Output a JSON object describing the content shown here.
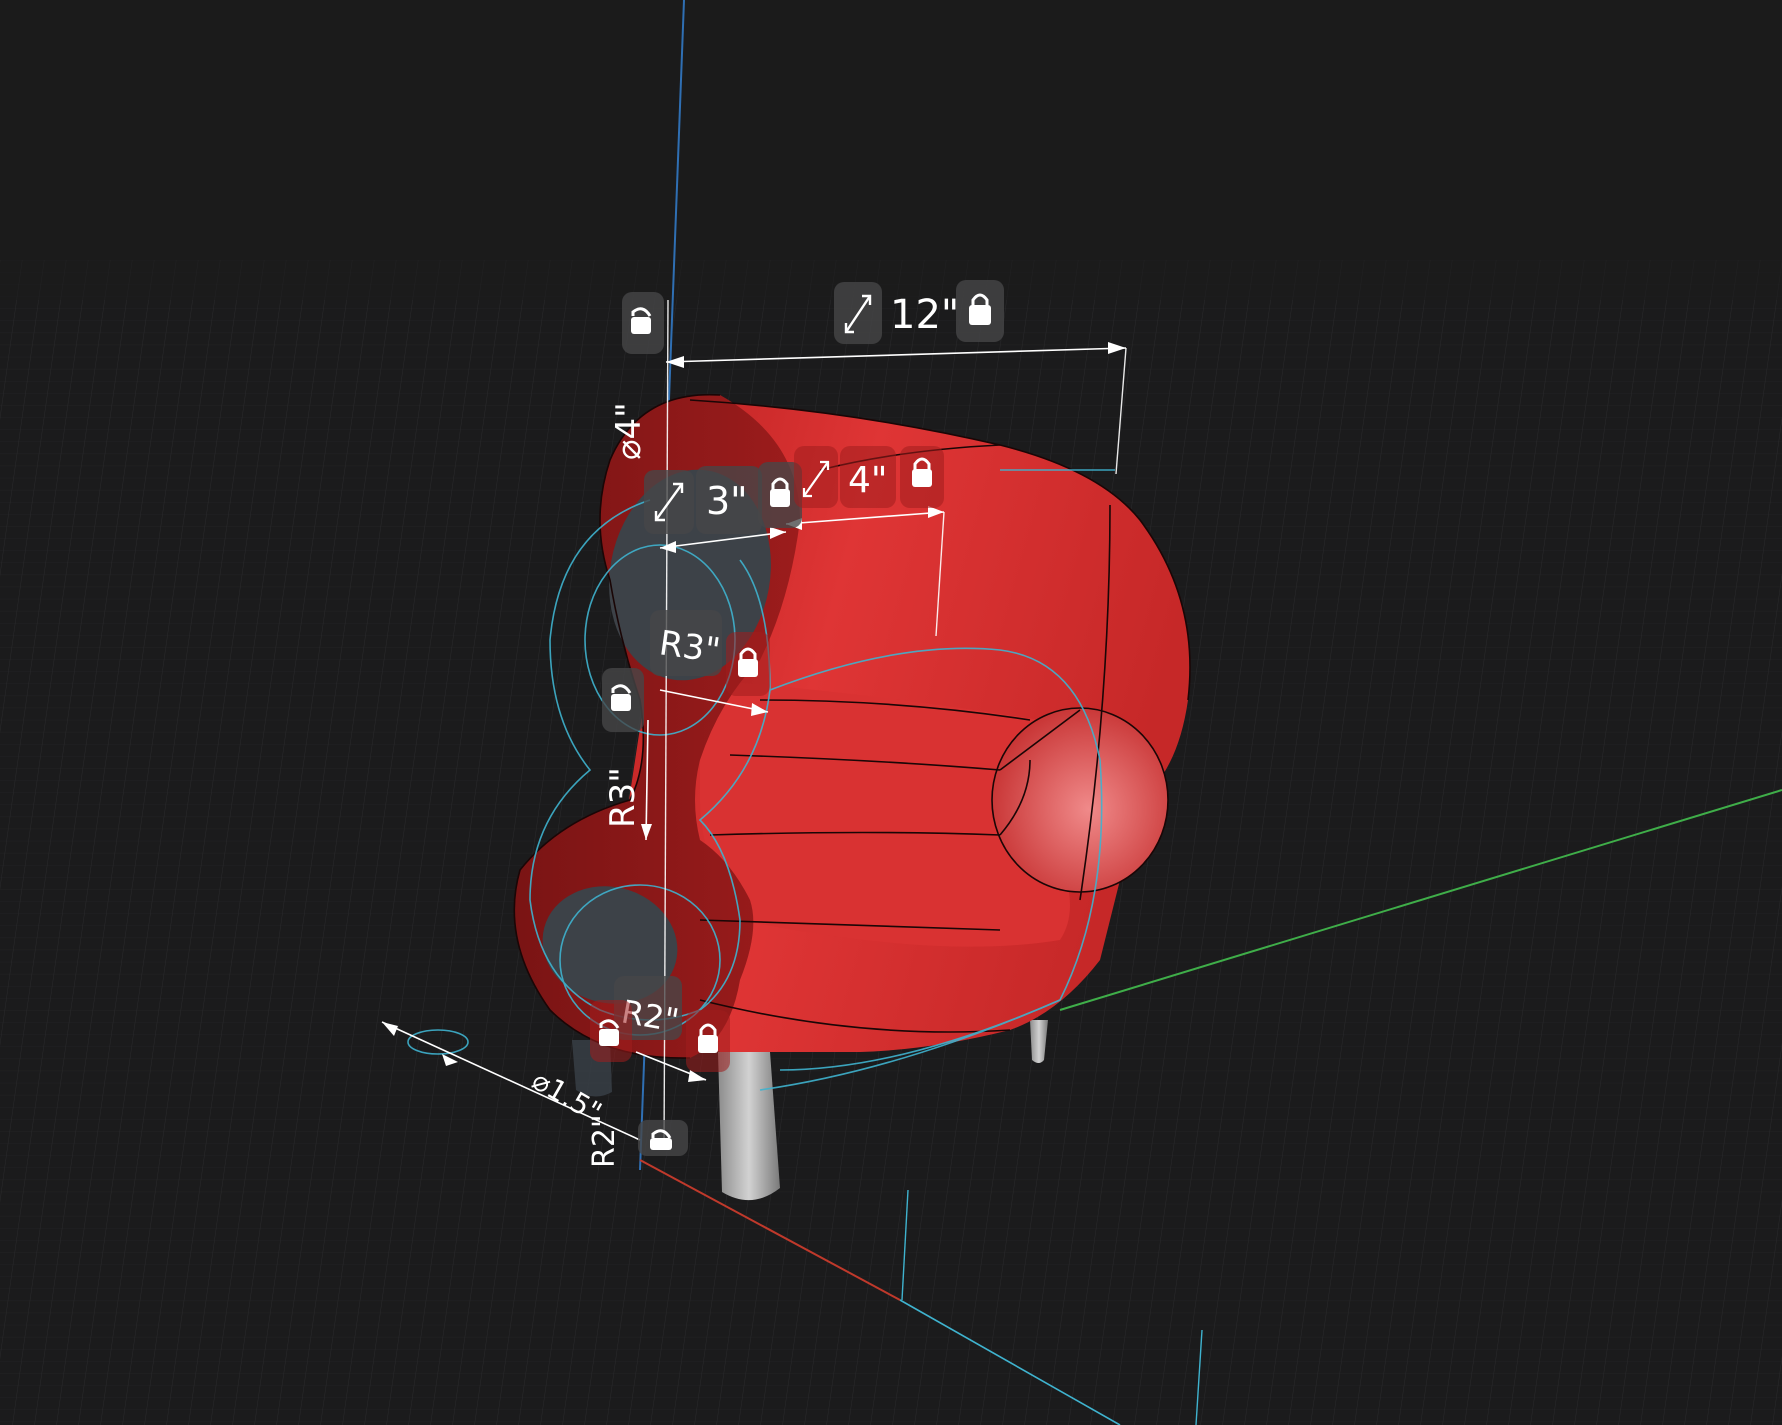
{
  "viewport": {
    "background": "#1b1b1c",
    "grid_color": "#2e2e30",
    "model_color": "#d32f2f",
    "axis_colors": {
      "x": "#c0392b",
      "y": "#3fae49",
      "z": "#2f6fb3"
    },
    "sketch_color": "#3fb3cf"
  },
  "dimensions": {
    "width": {
      "label": "12\"",
      "resize_icon": "resize-arrows-icon",
      "lock_icon": "lock-icon",
      "locked": true
    },
    "outer_dia": {
      "label": "⌀4\"",
      "lock_icon": "lock-icon",
      "locked": false
    },
    "hole_width": {
      "label": "3\"",
      "resize_icon": "resize-arrows-icon",
      "lock_icon": "lock-icon",
      "locked": true
    },
    "arm_depth": {
      "label": "4\"",
      "resize_icon": "resize-arrows-icon",
      "lock_icon": "lock-icon",
      "locked": true
    },
    "radius_upper": {
      "label": "R3\"",
      "lock_icon": "lock-icon",
      "locked": true
    },
    "radius_side": {
      "label": "R3\"",
      "lock_icon": "lock-icon",
      "locked": false
    },
    "radius_lower": {
      "label": "R2\"",
      "lock_icon": "lock-icon",
      "locked": true
    },
    "leg_dia": {
      "label": "⌀1.5\""
    },
    "leg_radius": {
      "label": "R2\"",
      "lock_icon": "lock-icon",
      "locked": false
    }
  }
}
